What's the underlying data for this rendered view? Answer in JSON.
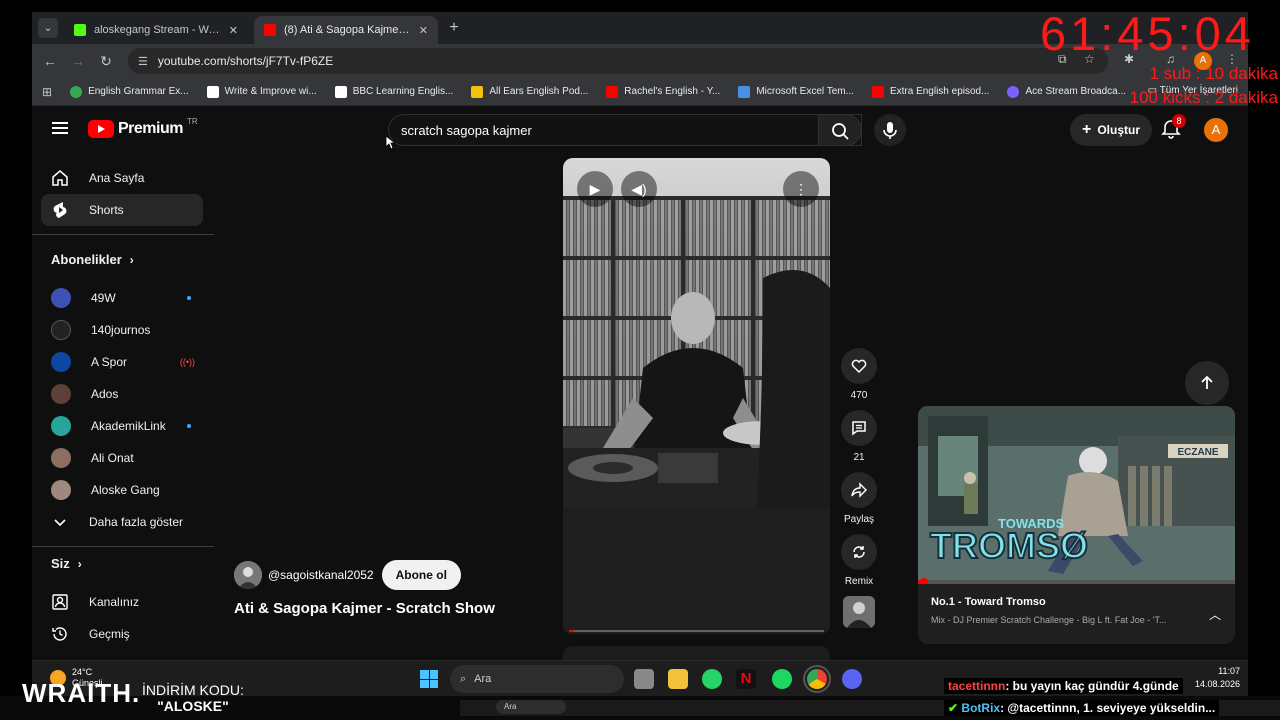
{
  "browser": {
    "tabs": [
      {
        "title": "aloskegang Stream - Watch Live",
        "favicon_color": "#53fc18"
      },
      {
        "title": "(8) Ati & Sagopa Kajmer - Scratch",
        "favicon_color": "#ff0000"
      }
    ],
    "url": "youtube.com/shorts/jF7Tv-fP6ZE",
    "profile_initial": "A",
    "bookmarks": [
      {
        "label": "English Grammar Ex...",
        "color": "#34a853"
      },
      {
        "label": "Write & Improve wi...",
        "color": "#ffffff"
      },
      {
        "label": "BBC Learning Englis...",
        "color": "#ffffff"
      },
      {
        "label": "All Ears English Pod...",
        "color": "#f4c20d"
      },
      {
        "label": "Rachel's English - Y...",
        "color": "#ff0000"
      },
      {
        "label": "Microsoft Excel Tem...",
        "color": "#4a90e2"
      },
      {
        "label": "Extra English episod...",
        "color": "#ff0000"
      },
      {
        "label": "Ace Stream Broadca...",
        "color": "#7b61ff"
      }
    ],
    "all_bookmarks_label": "Tüm Yer İşaretleri"
  },
  "youtube": {
    "logo_text": "Premium",
    "logo_region": "TR",
    "search_query": "scratch sagopa kajmer",
    "create_label": "Oluştur",
    "notification_count": "8",
    "avatar_initial": "A",
    "sidebar": {
      "home": "Ana Sayfa",
      "shorts": "Shorts",
      "subscriptions_title": "Abonelikler",
      "subscriptions": [
        {
          "name": "49W",
          "color": "#3f51b5",
          "indicator": "dot"
        },
        {
          "name": "140journos",
          "color": "#222222",
          "indicator": ""
        },
        {
          "name": "A Spor",
          "color": "#0d47a1",
          "indicator": "live"
        },
        {
          "name": "Ados",
          "color": "#5d4037",
          "indicator": ""
        },
        {
          "name": "AkademikLink",
          "color": "#26a69a",
          "indicator": "dot"
        },
        {
          "name": "Ali Onat",
          "color": "#8d6e63",
          "indicator": ""
        },
        {
          "name": "Aloske Gang",
          "color": "#a1887f",
          "indicator": ""
        }
      ],
      "show_more": "Daha fazla göster",
      "you_title": "Siz",
      "your_channel": "Kanalınız",
      "history": "Geçmiş"
    },
    "short": {
      "channel": "@sagoistkanal2052",
      "subscribe_label": "Abone ol",
      "title": "Ati & Sagopa Kajmer - Scratch Show",
      "likes": "470",
      "comments": "21",
      "share": "Paylaş",
      "remix": "Remix",
      "progress": 0.02
    },
    "miniplayer": {
      "title": "No.1 - Toward Tromso",
      "subtitle": "Mix - DJ Premier Scratch Challenge - Big L ft. Fat Joe - 'T...",
      "art_title": "TOWARDS TROMSØ",
      "sign": "ECZANE",
      "progress": 0.02
    }
  },
  "overlay": {
    "timer": "61:45:04",
    "rule1": "1 sub : 10 dakika",
    "rule2": "100 kicks : 2 dakika",
    "brand": "WRAITH.",
    "promo_label": "İNDİRİM KODU:",
    "promo_code": "\"ALOSKE\"",
    "chat": [
      {
        "user": "tacettinnn",
        "message": ": bu yayın kaç gündür 4.günde"
      },
      {
        "user": "BotRix",
        "message": ": @tacettinnn, 1. seviyeye yükseldin..."
      }
    ]
  },
  "taskbar": {
    "temperature": "24°C",
    "weather": "Güneşli",
    "search_placeholder": "Ara",
    "time": "11:07",
    "date": "14.08.2026",
    "small_search": "Ara"
  },
  "colors": {
    "accent_red": "#ff0000",
    "yt_bg": "#0f0f0f",
    "overlay_red": "#ff1a1a"
  }
}
